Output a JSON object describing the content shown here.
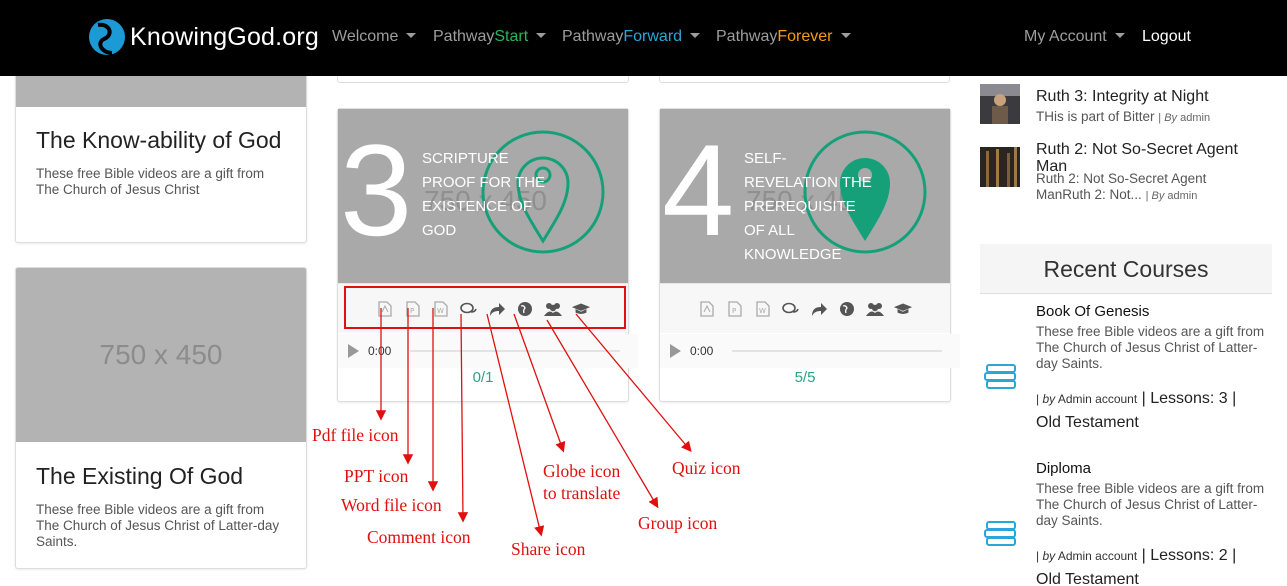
{
  "navbar": {
    "logo_text": "KnowingGod.org",
    "welcome": "Welcome",
    "pathway_start_prefix": "Pathway",
    "pathway_start_accent": "Start",
    "pathway_forward_prefix": "Pathway",
    "pathway_forward_accent": "Forward",
    "pathway_forever_prefix": "Pathway",
    "pathway_forever_accent": "Forever",
    "my_account": "My Account",
    "logout": "Logout"
  },
  "left_cards": [
    {
      "title": "The Know-ability of God",
      "description": "These free Bible videos are a gift from The Church of Jesus Christ"
    },
    {
      "placeholder": "750 x 450",
      "title": "The Existing Of God",
      "description": "These free Bible videos are a gift from The Church of Jesus Christ of Latter-day Saints."
    }
  ],
  "course_cards": [
    {
      "number": "3",
      "title": "Scripture Proof for the Existence of God",
      "placeholder": "750 x 450",
      "time": "0:00",
      "progress": "0/1"
    },
    {
      "number": "4",
      "title": "Self-Revelation the Prerequisite of All Knowledge",
      "placeholder": "750 x 450",
      "time": "0:00",
      "progress": "5/5"
    }
  ],
  "recent_posts": [
    {
      "title": "Ruth 3: Integrity at Night",
      "excerpt": "THis is part of Bitter",
      "by_label": "By",
      "author": "admin"
    },
    {
      "title": "Ruth 2: Not So-Secret Agent Man",
      "excerpt": "Ruth 2: Not So-Secret Agent ManRuth 2: Not...",
      "by_label": "By",
      "author": "admin"
    }
  ],
  "recent_courses": {
    "heading": "Recent Courses",
    "items": [
      {
        "title": "Book Of Genesis",
        "description": "These free Bible videos are a gift from The Church of Jesus Christ of Latter-day Saints.",
        "by_label": "by",
        "author": "Admin account",
        "lessons": "Lessons: 3",
        "category": "Old Testament"
      },
      {
        "title": "Diploma",
        "description": "These free Bible videos are a gift from The Church of Jesus Christ of Latter-day Saints.",
        "by_label": "by",
        "author": "Admin account",
        "lessons": "Lessons: 2",
        "category": "Old Testament"
      }
    ]
  },
  "annotations": {
    "pdf": "Pdf file icon",
    "ppt": "PPT icon",
    "word": "Word file icon",
    "comment": "Comment icon",
    "share": "Share icon",
    "globe_line1": "Globe icon",
    "globe_line2": "to translate",
    "group": "Group icon",
    "quiz": "Quiz icon"
  },
  "colors": {
    "navbar_bg": "#000000",
    "accent_start": "#2cb45a",
    "accent_forward": "#2aa6d8",
    "accent_forever": "#f39c12",
    "pin_green": "#16a07a",
    "annotation_red": "#e01010",
    "progress_green": "#2ba37e"
  }
}
